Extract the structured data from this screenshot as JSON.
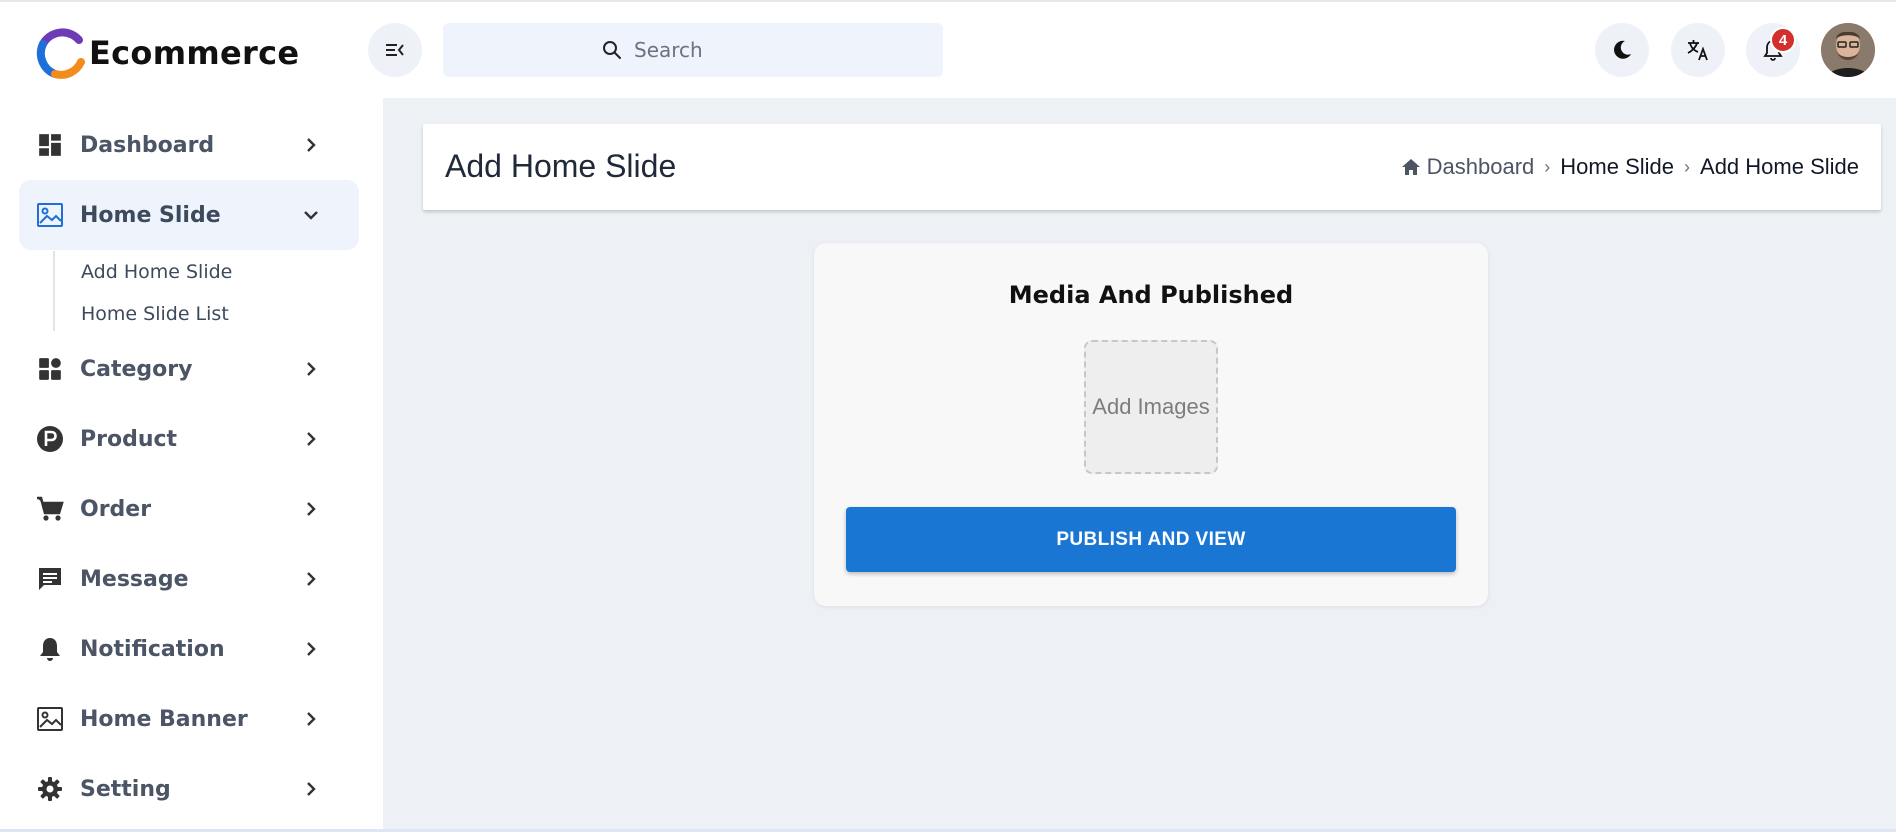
{
  "brand": {
    "name": "Ecommerce"
  },
  "header": {
    "search_placeholder": "Search",
    "notification_count": "4"
  },
  "sidebar": {
    "items": [
      {
        "label": "Dashboard",
        "icon": "dashboard-icon"
      },
      {
        "label": "Home Slide",
        "icon": "image-icon"
      },
      {
        "label": "Category",
        "icon": "category-grid-icon"
      },
      {
        "label": "Product",
        "icon": "product-p-icon"
      },
      {
        "label": "Order",
        "icon": "cart-icon"
      },
      {
        "label": "Message",
        "icon": "message-icon"
      },
      {
        "label": "Notification",
        "icon": "bell-icon"
      },
      {
        "label": "Home Banner",
        "icon": "image-icon"
      },
      {
        "label": "Setting",
        "icon": "gear-icon"
      }
    ],
    "submenu": [
      "Add Home Slide",
      "Home Slide List"
    ]
  },
  "page": {
    "title": "Add Home Slide",
    "breadcrumb": [
      "Dashboard",
      "Home Slide",
      "Add Home Slide"
    ]
  },
  "card": {
    "title": "Media And Published",
    "upload_label": "Add Images",
    "publish_label": "PUBLISH AND VIEW"
  },
  "colors": {
    "accent": "#1976d2",
    "badge": "#d32f2f",
    "active_bg": "#eef3fc",
    "main_bg": "#edf0f5"
  }
}
